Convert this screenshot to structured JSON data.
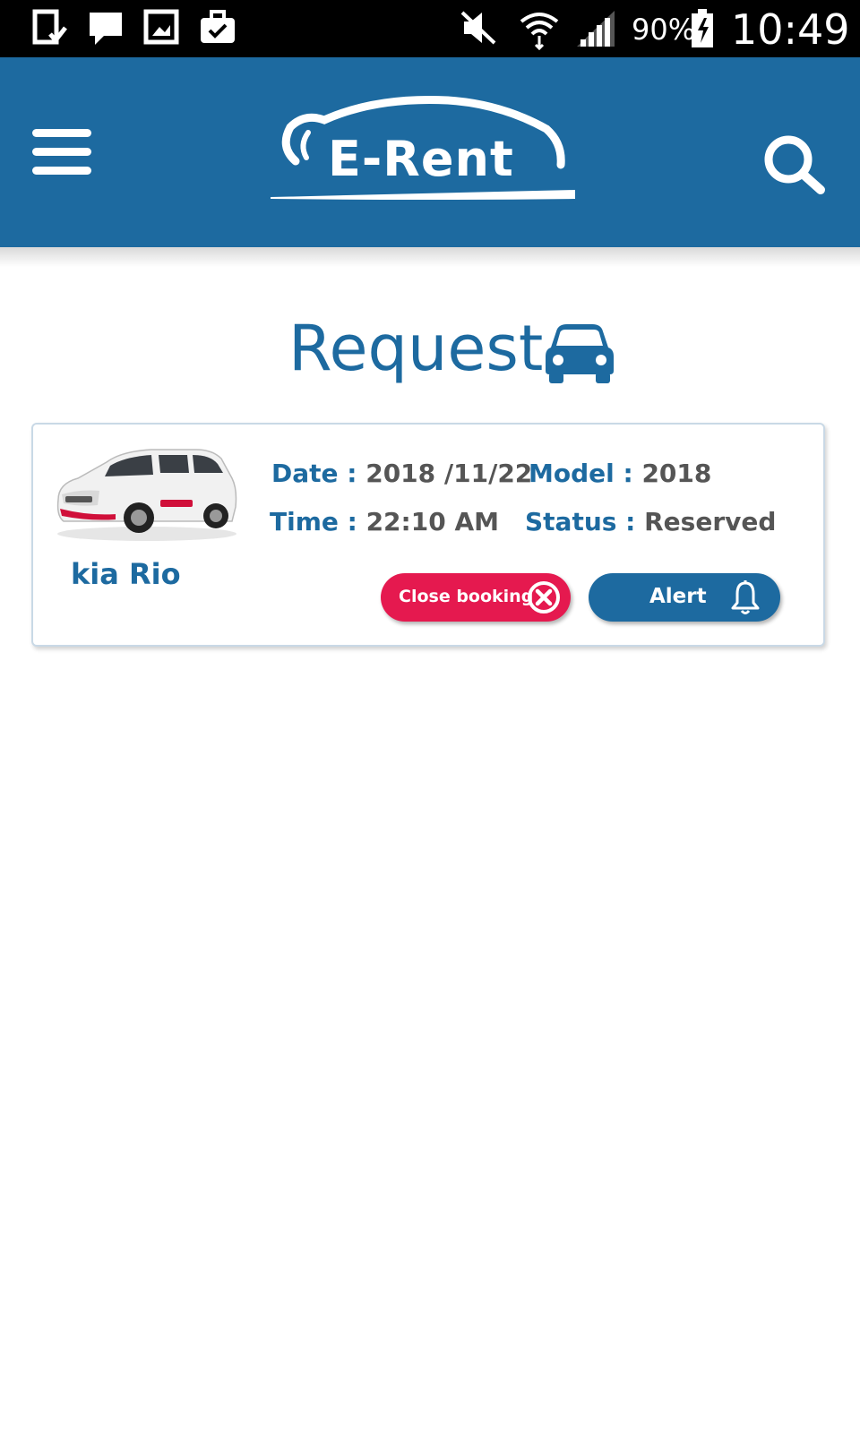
{
  "status_bar": {
    "battery_percent": "90%",
    "time": "10:49",
    "icons": [
      "task-icon",
      "message-icon",
      "image-icon",
      "briefcase-icon",
      "mute-icon",
      "wifi-icon",
      "signal-icon",
      "battery-icon"
    ]
  },
  "header": {
    "logo_text": "E-Rent",
    "menu_icon": "hamburger-icon",
    "search_icon": "search-icon"
  },
  "page": {
    "title": "Request",
    "title_icon": "car-icon"
  },
  "bookings": [
    {
      "car_name": "kia Rio",
      "date_label": "Date :",
      "date_value": "2018 /11/22",
      "model_label": "Model :",
      "model_value": "2018",
      "time_label": "Time :",
      "time_value": "22:10 AM",
      "status_label": "Status :",
      "status_value": "Reserved",
      "close_button_label": "Close booking",
      "alert_button_label": "Alert"
    }
  ],
  "colors": {
    "primary": "#1d6aa0",
    "danger": "#e5194f",
    "value_text": "#555555"
  }
}
